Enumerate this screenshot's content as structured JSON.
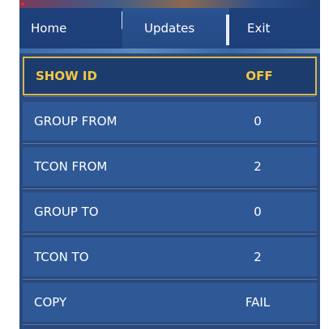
{
  "nav": {
    "tabs": [
      {
        "label": "Home"
      },
      {
        "label": "Updates"
      },
      {
        "label": "Exit"
      }
    ]
  },
  "menu": {
    "items": [
      {
        "label": "SHOW ID",
        "value": "OFF",
        "selected": true
      },
      {
        "label": "GROUP FROM",
        "value": "0"
      },
      {
        "label": "TCON FROM",
        "value": "2"
      },
      {
        "label": "GROUP TO",
        "value": "0"
      },
      {
        "label": "TCON TO",
        "value": "2"
      },
      {
        "label": "COPY",
        "value": "FAIL"
      }
    ]
  },
  "colors": {
    "background": "#2a4a7f",
    "row": "#2f5896",
    "selected_text": "#f5c842",
    "selected_border": "#d8b84a"
  }
}
